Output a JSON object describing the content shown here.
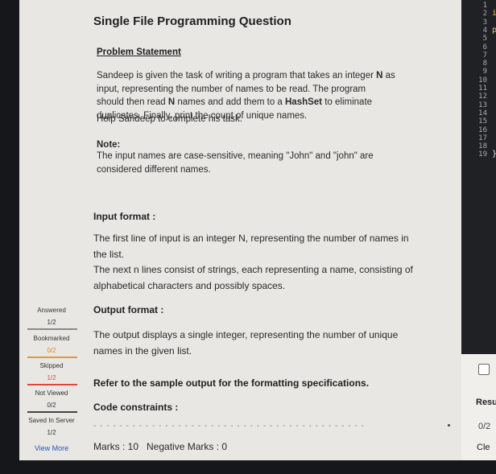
{
  "question": {
    "title": "Single File Programming Question",
    "problem_statement_heading": "Problem Statement",
    "statement_lines": [
      [
        "Sandeep is given the task of writing a program that takes an integer ",
        {
          "b": "N"
        },
        " as"
      ],
      [
        "input, representing the number of names to be read. The program"
      ],
      [
        "should then read ",
        {
          "b": "N"
        },
        " names and add them to a ",
        {
          "b": "HashSet"
        },
        " to eliminate"
      ],
      [
        "duplicates. Finally, print the count of unique names."
      ]
    ],
    "help_text": "Help Sandeep to complete his task.",
    "note_heading": "Note:",
    "note_lines": [
      "The input names are case-sensitive, meaning \"John\" and \"john\" are",
      "considered different names."
    ],
    "input_format_heading": "Input format :",
    "input_format_lines": [
      "The first line of input is an integer N, representing the number of names in",
      "the list.",
      "The next n lines consist of strings, each representing a name, consisting of",
      "alphabetical characters and possibly spaces."
    ],
    "output_format_heading": "Output format :",
    "output_format_lines": [
      "The output displays a single integer, representing the number of unique",
      "names in the given list."
    ],
    "sample_ref": "Refer to the sample output for the formatting specifications.",
    "code_constraints_heading": "Code constraints :"
  },
  "footer": {
    "marks": "Marks : 10",
    "negative_marks": "Negative Marks : 0"
  },
  "sidebar": {
    "stats": [
      {
        "label": "Answered",
        "value": "1/2",
        "color": "#8a8a8a"
      },
      {
        "label": "Bookmarked",
        "value": "0/2",
        "color": "#e0973a"
      },
      {
        "label": "Skipped",
        "value": "1/2",
        "color": "#d9473f"
      },
      {
        "label": "Not Viewed",
        "value": "0/2",
        "color": "#444444"
      },
      {
        "label": "Saved In Server",
        "value": "1/2",
        "color": "#8a8a8a"
      }
    ],
    "view_more": "View More"
  },
  "editor": {
    "line_numbers": [
      "1",
      "2",
      "3",
      "4",
      "5",
      "6",
      "7",
      "8",
      "9",
      "10",
      "11",
      "12",
      "13",
      "14",
      "15",
      "16",
      "17",
      "18",
      "19"
    ],
    "fragments": [
      {
        "line": 2,
        "text": "i",
        "color": "#e8c46b"
      },
      {
        "line": 4,
        "text": "p",
        "color": "#e8c46b"
      },
      {
        "line": 19,
        "text": "}",
        "color": "#e6e6e6"
      }
    ]
  },
  "right_panel": {
    "result_label": "Resu",
    "ratio_text": "0/2",
    "clear_label": "Cle"
  },
  "colors": {
    "accent_blue": "#2b53b8",
    "editor_bg": "#202124",
    "panel_bg": "#e9e7e3"
  }
}
